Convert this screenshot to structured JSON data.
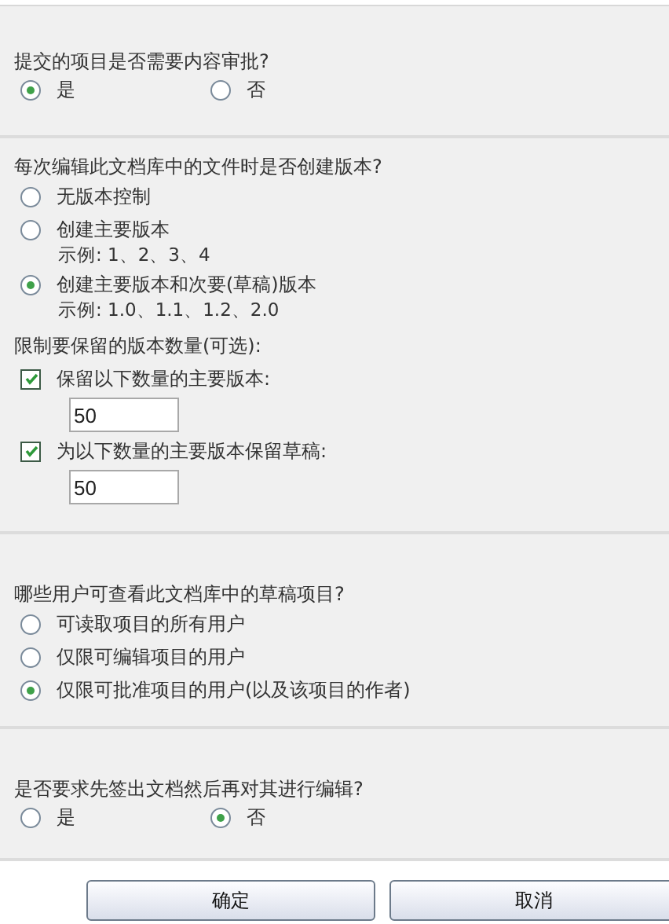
{
  "sections": [
    {
      "question": "提交的项目是否需要内容审批?",
      "kind": "row",
      "options": [
        {
          "label": "是",
          "selected": true
        },
        {
          "label": "否",
          "selected": false
        }
      ]
    },
    {
      "question": "每次编辑此文档库中的文件时是否创建版本?",
      "kind": "column",
      "options": [
        {
          "label": "无版本控制",
          "selected": false
        },
        {
          "label": "创建主要版本",
          "example": "示例: 1、2、3、4",
          "selected": false
        },
        {
          "label": "创建主要版本和次要(草稿)版本",
          "example": "示例: 1.0、1.1、1.2、2.0",
          "selected": true
        }
      ],
      "limits": {
        "heading": "限制要保留的版本数量(可选):",
        "items": [
          {
            "label": "保留以下数量的主要版本:",
            "checked": true,
            "value": "50"
          },
          {
            "label": "为以下数量的主要版本保留草稿:",
            "checked": true,
            "value": "50"
          }
        ]
      }
    },
    {
      "question": "哪些用户可查看此文档库中的草稿项目?",
      "kind": "column",
      "options": [
        {
          "label": "可读取项目的所有用户",
          "selected": false
        },
        {
          "label": "仅限可编辑项目的用户",
          "selected": false
        },
        {
          "label": "仅限可批准项目的用户(以及该项目的作者)",
          "selected": true
        }
      ]
    },
    {
      "question": "是否要求先签出文档然后再对其进行编辑?",
      "kind": "row",
      "options": [
        {
          "label": "是",
          "selected": false
        },
        {
          "label": "否",
          "selected": true
        }
      ]
    }
  ],
  "buttons": [
    "确定",
    "取消"
  ]
}
